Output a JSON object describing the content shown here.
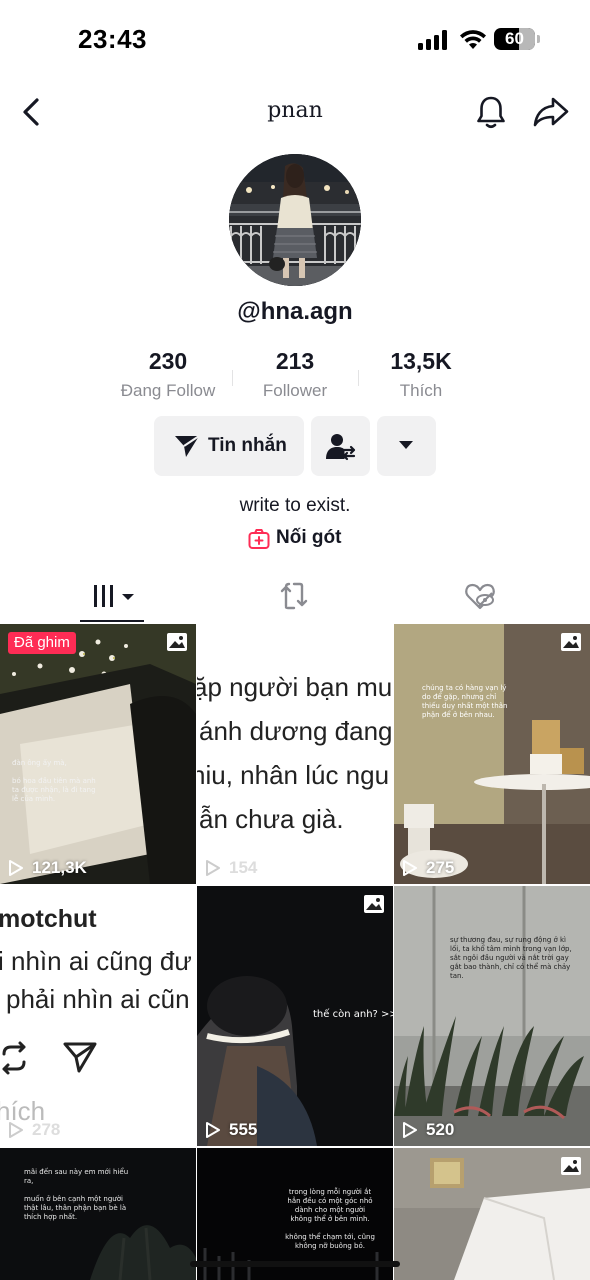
{
  "status_bar": {
    "time": "23:43",
    "battery": "60",
    "battery_level": 0.6
  },
  "header": {
    "title": "pnan"
  },
  "profile": {
    "username": "@hna.agn",
    "stats": [
      {
        "value": "230",
        "label": "Đang Follow"
      },
      {
        "value": "213",
        "label": "Follower"
      },
      {
        "value": "13,5K",
        "label": "Thích"
      }
    ],
    "message_button": "Tin nhắn",
    "bio": "write to exist.",
    "link_label": "Nối gót"
  },
  "videos": [
    {
      "views": "121,3K",
      "pinned_label": "Đã ghim",
      "caption": "đàn ông ấy mà,\n\nbó hoa đầu tiên mà anh ta được nhận, là đi tang lễ của mình."
    },
    {
      "views": "154",
      "lines": [
        "ặp người bạn mu",
        "ánh dương đang",
        "niu, nhân lúc ngu",
        "ẫn chưa già."
      ]
    },
    {
      "views": "275",
      "caption": "chúng ta có hàng vạn lý do để gặp, nhưng chỉ thiếu duy nhất một thân phận để ở bên nhau."
    },
    {
      "views": "278",
      "lines": [
        "motchut",
        "i nhìn ai cũng đư",
        "phải nhìn ai cũn"
      ],
      "footer": "hích"
    },
    {
      "views": "555",
      "caption": "thế còn anh? >>"
    },
    {
      "views": "520",
      "caption": "sự thương đau, sự rung động ở kì lối, ta khổ tâm mình trong vạn lớp, sắt ngôi đầu người và nắt trời gay gắt bao thành, chỉ có thể mà chảy tan."
    },
    {
      "caption": "mãi đến sau này em mới hiểu ra,\n\nmuốn ở bên cạnh một người thật lâu, thân phận bạn bè là thích hợp nhất."
    },
    {
      "caption": "trong lòng mỗi người ắt hẳn đều có một góc nhỏ dành cho một người không thể ở bên mình.\n\nkhông thể chạm tới, cũng không nỡ buông bỏ."
    },
    {}
  ]
}
